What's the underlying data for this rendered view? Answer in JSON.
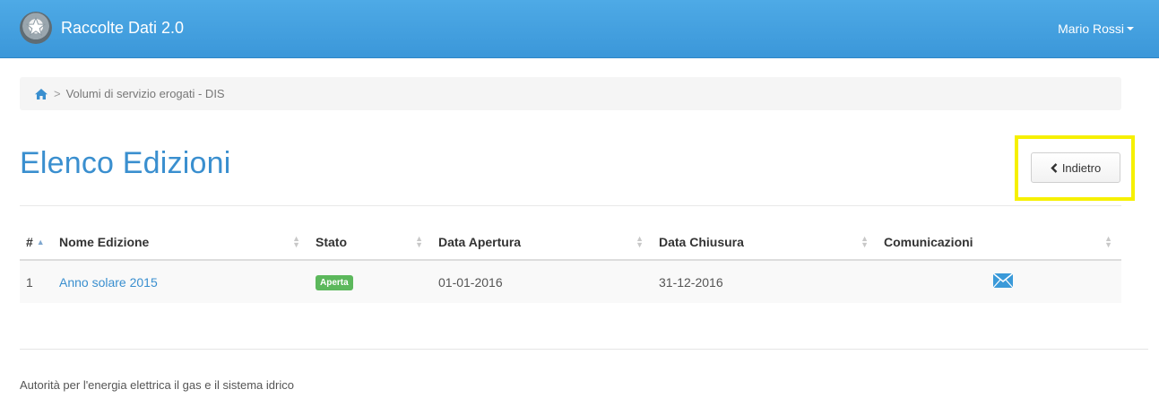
{
  "header": {
    "app_title": "Raccolte Dati 2.0",
    "user_name": "Mario Rossi",
    "color": "#43a0e0"
  },
  "breadcrumb": {
    "home_icon": "home-icon",
    "separator": ">",
    "current": "Volumi di servizio erogati - DIS"
  },
  "page": {
    "title": "Elenco Edizioni",
    "back_label": "Indietro",
    "highlight_color": "#f6f000"
  },
  "table": {
    "columns": [
      "#",
      "Nome Edizione",
      "Stato",
      "Data Apertura",
      "Data Chiusura",
      "Comunicazioni"
    ],
    "rows": [
      {
        "num": "1",
        "name": "Anno solare 2015",
        "status": "Aperta",
        "opening": "01-01-2016",
        "closing": "31-12-2016",
        "comm_icon": "envelope-icon"
      }
    ],
    "status_color": "#5cb85c"
  },
  "footer": {
    "text": "Autorità per l'energia elettrica il gas e il sistema idrico"
  }
}
